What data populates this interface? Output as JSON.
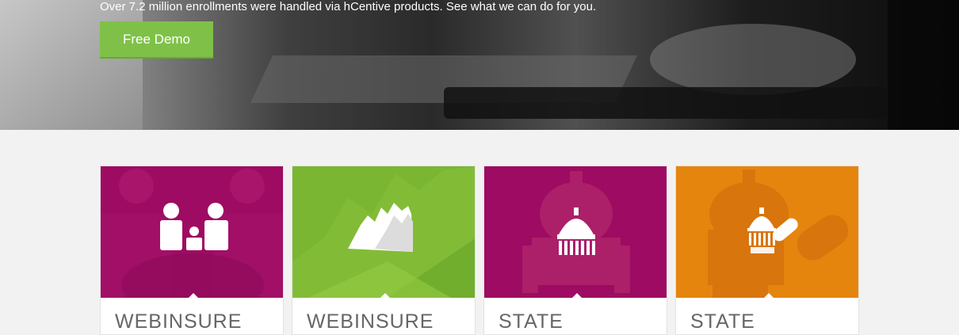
{
  "hero": {
    "tagline": "Over 7.2 million enrollments were handled via hCentive products. See what we can do for you.",
    "demo_button": "Free Demo",
    "button_color": "#7fc148"
  },
  "cards": [
    {
      "title": "WEBINSURE",
      "color": "#9e0b62",
      "icon": "family-icon"
    },
    {
      "title": "WEBINSURE",
      "color": "#7ab632",
      "icon": "mountain-chart-icon"
    },
    {
      "title": "STATE",
      "color": "#9e0b62",
      "icon": "capitol-building-icon"
    },
    {
      "title": "STATE",
      "color": "#e6850e",
      "icon": "capitol-pill-icon"
    }
  ]
}
